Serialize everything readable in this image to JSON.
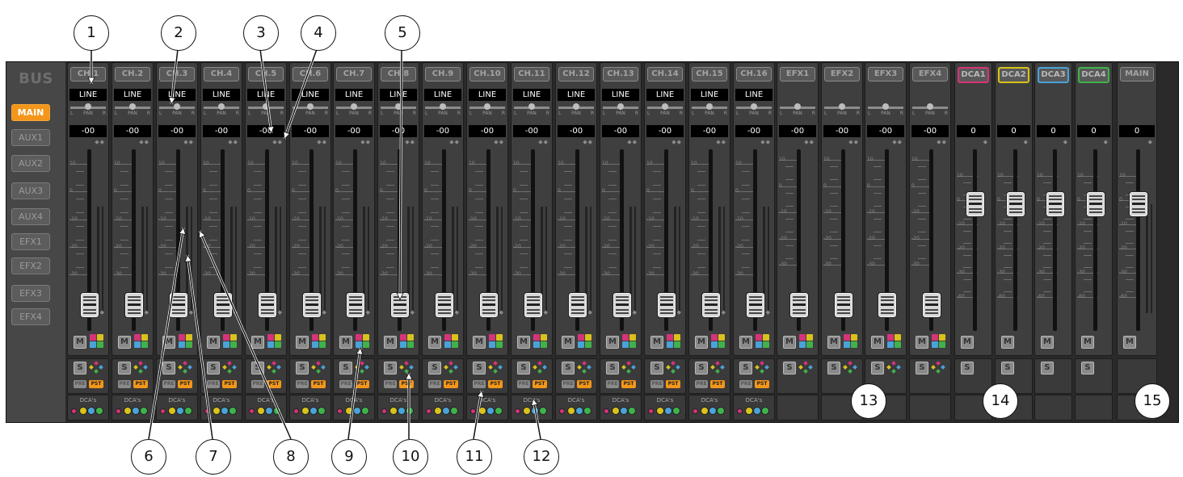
{
  "sidebar": {
    "title": "BUS",
    "buttons": [
      "MAIN",
      "AUX1",
      "AUX2",
      "AUX3",
      "AUX4",
      "EFX1",
      "EFX2",
      "EFX3",
      "EFX4"
    ],
    "active": "MAIN"
  },
  "channels": [
    {
      "name": "CH.1",
      "source": "LINE",
      "value": "-00"
    },
    {
      "name": "CH.2",
      "source": "LINE",
      "value": "-00"
    },
    {
      "name": "CH.3",
      "source": "LINE",
      "value": "-00"
    },
    {
      "name": "CH.4",
      "source": "LINE",
      "value": "-00"
    },
    {
      "name": "CH.5",
      "source": "LINE",
      "value": "-00"
    },
    {
      "name": "CH.6",
      "source": "LINE",
      "value": "-00"
    },
    {
      "name": "CH.7",
      "source": "LINE",
      "value": "-00"
    },
    {
      "name": "CH.8",
      "source": "LINE",
      "value": "-00"
    },
    {
      "name": "CH.9",
      "source": "LINE",
      "value": "-00"
    },
    {
      "name": "CH.10",
      "source": "LINE",
      "value": "-00"
    },
    {
      "name": "CH.11",
      "source": "LINE",
      "value": "-00"
    },
    {
      "name": "CH.12",
      "source": "LINE",
      "value": "-00"
    },
    {
      "name": "CH.13",
      "source": "LINE",
      "value": "-00"
    },
    {
      "name": "CH.14",
      "source": "LINE",
      "value": "-00"
    },
    {
      "name": "CH.15",
      "source": "LINE",
      "value": "-00"
    },
    {
      "name": "CH.16",
      "source": "LINE",
      "value": "-00"
    }
  ],
  "efx": [
    {
      "name": "EFX1",
      "value": "-00"
    },
    {
      "name": "EFX2",
      "value": "-00"
    },
    {
      "name": "EFX3",
      "value": "-00"
    },
    {
      "name": "EFX4",
      "value": "-00"
    }
  ],
  "dca": [
    {
      "name": "DCA1",
      "value": "0",
      "color": "#d6337a"
    },
    {
      "name": "DCA2",
      "value": "0",
      "color": "#d9c21b"
    },
    {
      "name": "DCA3",
      "value": "0",
      "color": "#4aa3d8"
    },
    {
      "name": "DCA4",
      "value": "0",
      "color": "#3fb34a"
    }
  ],
  "main": {
    "name": "MAIN",
    "value": "0"
  },
  "labels": {
    "pan": "PAN",
    "pan_left": "L",
    "pan_right": "R",
    "mute": "M",
    "solo": "S",
    "pre": "PRE",
    "pst": "PST",
    "dcas": "DCA's"
  },
  "scale_ch": [
    "10",
    "0",
    "-10",
    "-20",
    "-30"
  ],
  "scale_efx": [
    "10",
    "0",
    "-10",
    "-20",
    "-30"
  ],
  "scale_dca": [
    "10",
    "0",
    "-10",
    "-20",
    "-30",
    "-60"
  ],
  "colors": {
    "accent": "#f3961a",
    "dca": [
      "#d6337a",
      "#d9c21b",
      "#4aa3d8",
      "#3fb34a"
    ],
    "dca_dots": [
      "#d6337a",
      "#d9c21b",
      "#4aa3d8",
      "#3fb34a"
    ],
    "solo_diamonds": [
      "#d6337a",
      "#d9c21b",
      "#4aa3d8",
      "#3fb34a"
    ]
  },
  "callouts": [
    "1",
    "2",
    "3",
    "4",
    "5",
    "6",
    "7",
    "8",
    "9",
    "10",
    "11",
    "12",
    "13",
    "14",
    "15"
  ]
}
